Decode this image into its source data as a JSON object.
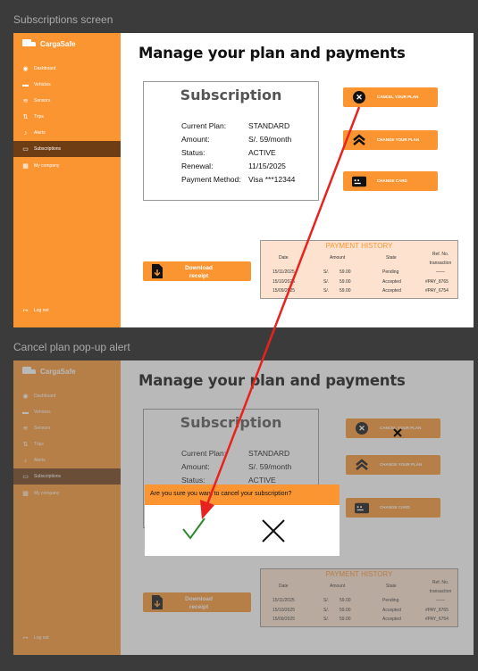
{
  "frames": [
    {
      "label": "Subscriptions screen"
    },
    {
      "label": "Cancel plan pop-up alert"
    }
  ],
  "app": {
    "name": "CargaSafe"
  },
  "sidebar": {
    "items": [
      {
        "label": "Dashboard",
        "icon": "dashboard-icon"
      },
      {
        "label": "Vehicles",
        "icon": "truck-icon"
      },
      {
        "label": "Sensors",
        "icon": "sensor-icon"
      },
      {
        "label": "Trips",
        "icon": "trips-icon"
      },
      {
        "label": "Alerts",
        "icon": "bell-icon"
      },
      {
        "label": "Subscriptions",
        "icon": "card-icon",
        "active": true
      },
      {
        "label": "My company",
        "icon": "building-icon"
      }
    ],
    "logout": "Log out"
  },
  "main": {
    "title": "Manage your plan and payments",
    "subscription": {
      "title": "Subscription",
      "rows": [
        {
          "key": "Current Plan:",
          "value": "STANDARD"
        },
        {
          "key": "Amount:",
          "value": "S/. 59/month"
        },
        {
          "key": "Status:",
          "value": "ACTIVE"
        },
        {
          "key": "Renewal:",
          "value": "11/15/2025"
        },
        {
          "key": "Payment Method:",
          "value": "Visa ***12344"
        }
      ]
    },
    "actions": {
      "cancel": "CANCEL YOUR PLAN",
      "change_plan": "CHANGE YOUR PLAN",
      "change_card": "CHANGE CARD"
    },
    "download": "Download receipt",
    "history": {
      "title": "PAYMENT HISTORY",
      "headers": {
        "date": "Date",
        "amount": "Amount",
        "state": "State",
        "ref": "Ref. No. transaction"
      },
      "rows": [
        {
          "date": "15/11/2025",
          "cur": "S/.",
          "amount": "59.00",
          "state": "Pending",
          "ref": "——"
        },
        {
          "date": "15/10/2025",
          "cur": "S/.",
          "amount": "59.00",
          "state": "Accepted",
          "ref": "#PAY_8765"
        },
        {
          "date": "15/09/2025",
          "cur": "S/.",
          "amount": "59.00",
          "state": "Accepted",
          "ref": "#PAY_6754"
        }
      ]
    }
  },
  "modal": {
    "question": "Are you sure you want to cancel your subscription?"
  },
  "colors": {
    "accent": "#fb9532",
    "active_nav": "#6f3d14",
    "arrow": "#e8221e",
    "ok": "#2a8a2a"
  }
}
